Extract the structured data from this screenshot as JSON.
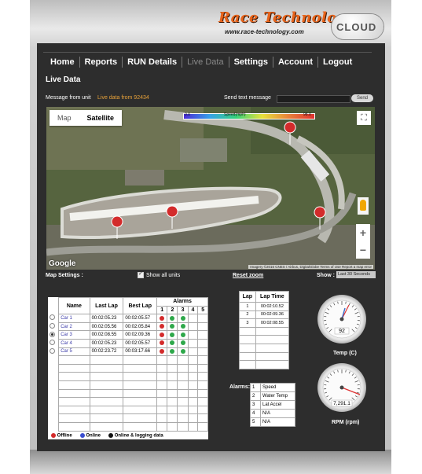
{
  "logo": {
    "title": "Race Technology",
    "url": "www.race-technology.com",
    "cloud": "CLOUD"
  },
  "nav": {
    "items": [
      "Home",
      "Reports",
      "RUN Details",
      "Live Data",
      "Settings",
      "Account",
      "Logout"
    ],
    "active": "Live Data"
  },
  "page_title": "Live Data",
  "message": {
    "label": "Message from unit",
    "value": "Live data from 92434"
  },
  "send": {
    "label": "Send text message",
    "button": "Send"
  },
  "map": {
    "tabs": [
      "Map",
      "Satellite"
    ],
    "selected_tab": "Satellite",
    "speed_title": "Speed(mph)",
    "speed_min": "0.0",
    "speed_max": "98.0",
    "google": "Google",
    "attribution": "Imagery ©2016 CNES / Airbus, DigitalGlobe   Terms of Use   Report a map error"
  },
  "map_settings": {
    "label": "Map Settings :",
    "show_all": "Show all units",
    "reset": "Reset zoom",
    "show_label": "Show :",
    "show_value": "Last 30 Seconds"
  },
  "cars": {
    "headers": [
      "Name",
      "Last Lap",
      "Best Lap",
      "Alarms"
    ],
    "alarm_cols": [
      "1",
      "2",
      "3",
      "4",
      "5"
    ],
    "rows": [
      {
        "name": "Car 1",
        "last": "00:02:05.23",
        "best": "00:02:05.57",
        "alarms": [
          "red",
          "green",
          "green",
          "",
          ""
        ]
      },
      {
        "name": "Car 2",
        "last": "00:02:05.56",
        "best": "00:02:05.84",
        "alarms": [
          "red",
          "green",
          "green",
          "",
          ""
        ]
      },
      {
        "name": "Car 3",
        "last": "00:02:08.55",
        "best": "00:02:09.36",
        "alarms": [
          "red",
          "green",
          "green",
          "",
          ""
        ]
      },
      {
        "name": "Car 4",
        "last": "00:02:05.23",
        "best": "00:02:05.57",
        "alarms": [
          "red",
          "green",
          "green",
          "",
          ""
        ]
      },
      {
        "name": "Car 5",
        "last": "00:02:23.72",
        "best": "00:03:17.66",
        "alarms": [
          "red",
          "green",
          "green",
          "",
          ""
        ]
      }
    ],
    "selected": 2
  },
  "legend": [
    "Offline",
    "Online",
    "Online & logging data"
  ],
  "laps": {
    "headers": [
      "Lap",
      "Lap Time"
    ],
    "rows": [
      {
        "lap": "1",
        "time": "00:02:10.52"
      },
      {
        "lap": "2",
        "time": "00:02:09.36"
      },
      {
        "lap": "3",
        "time": "00:02:08.55"
      }
    ]
  },
  "alarms": {
    "label": "Alarms:",
    "items": [
      {
        "n": "1",
        "name": "Speed"
      },
      {
        "n": "2",
        "name": "Water Temp"
      },
      {
        "n": "3",
        "name": "Lat Accel"
      },
      {
        "n": "4",
        "name": "N/A"
      },
      {
        "n": "5",
        "name": "N/A"
      }
    ]
  },
  "gauges": {
    "temp": {
      "label": "Temp (C)",
      "value": "92"
    },
    "rpm": {
      "label": "RPM (rpm)",
      "value": "7,291.1"
    }
  },
  "colors": {
    "panel": "#2d2d2d",
    "accent": "#e8641b",
    "offline": "#d32b2b",
    "online": "#3a4ed0",
    "logging": "#111111"
  }
}
